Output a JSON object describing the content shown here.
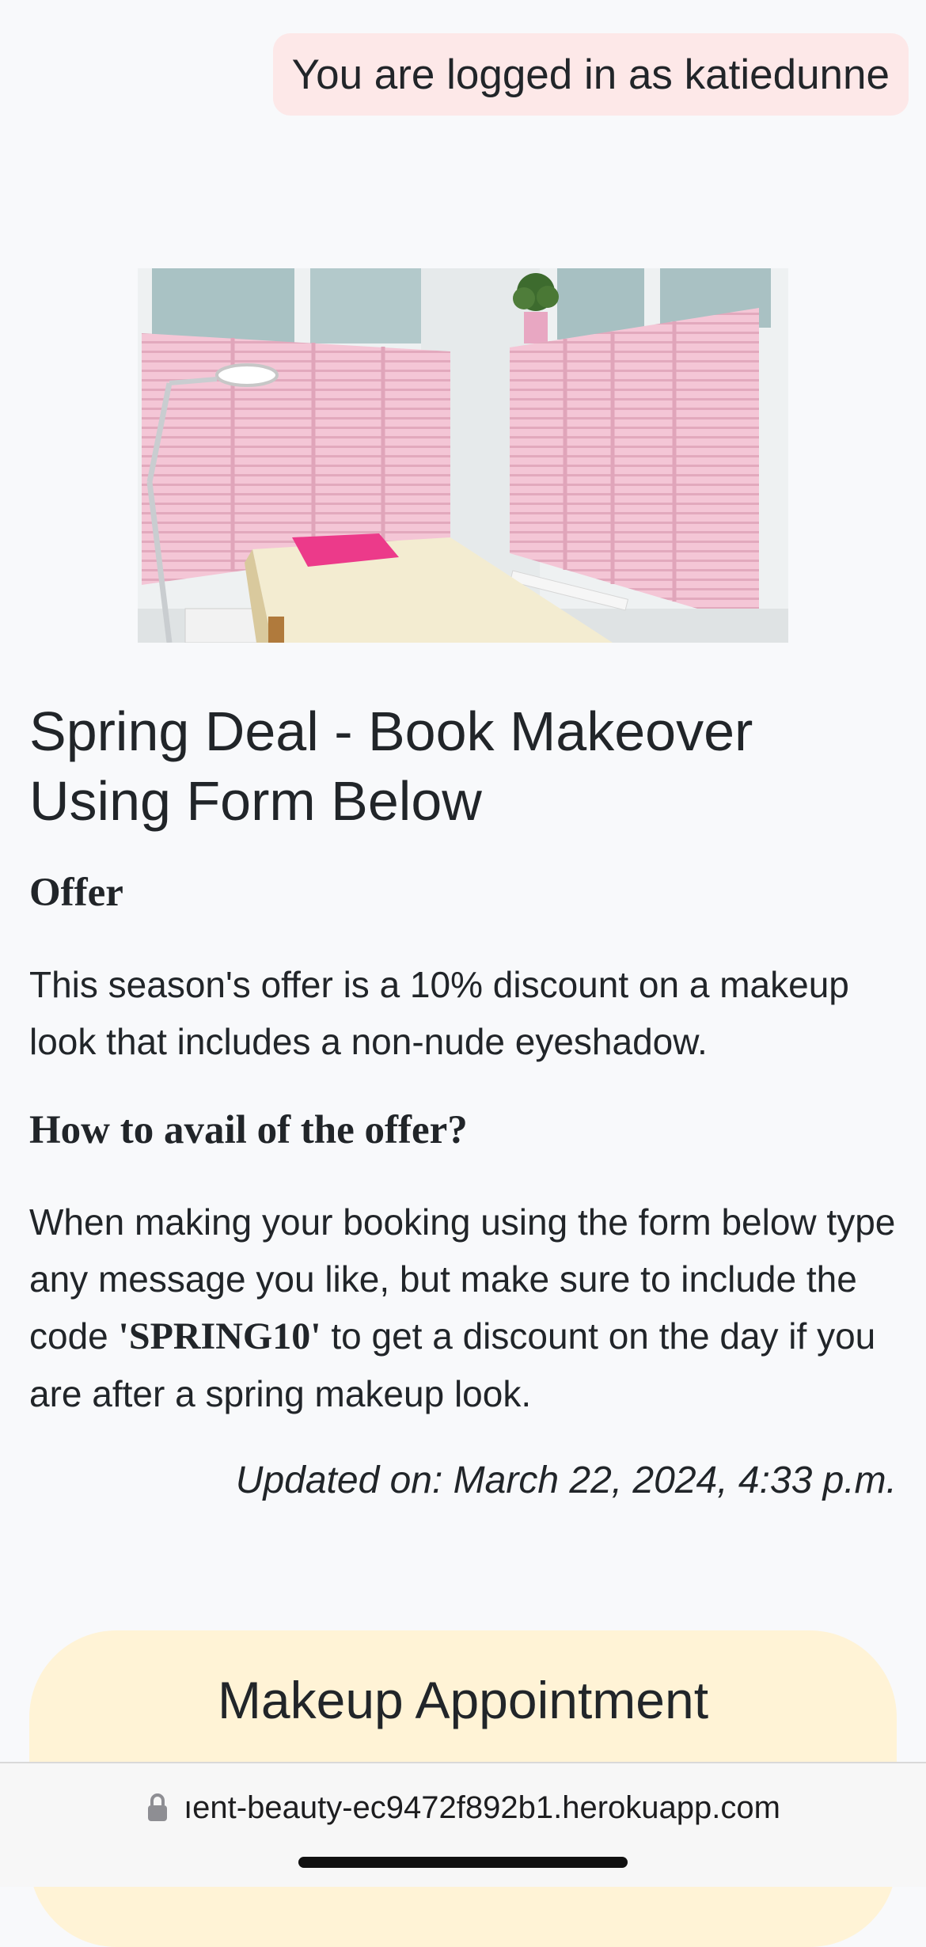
{
  "header": {
    "login_status": "You are logged in as katiedunne"
  },
  "post": {
    "title": "Spring Deal - Book Makeover Using Form Below",
    "offer_heading": "Offer",
    "offer_text": "This season's offer is a 10% discount on a makeup look that includes a non-nude eyeshadow.",
    "how_heading": "How to avail of the offer?",
    "how_text_before": "When making your booking using the form below type any message you like, but make sure to include the code ",
    "how_code": "'SPRING10'",
    "how_text_after": " to get a discount on the day if you are after a spring makeup look.",
    "updated": "Updated on: March 22, 2024, 4:33 p.m."
  },
  "appointment": {
    "title": "Makeup Appointment"
  },
  "browser": {
    "url": "ıent-beauty-ec9472f892b1.herokuapp.com"
  },
  "icons": {
    "lock": "lock-icon"
  },
  "colors": {
    "page_background": "#f8f9fb",
    "login_badge_background": "#fde8e8",
    "appointment_card_background": "#fff3d6",
    "shutter_pink": "#f4c6d6",
    "pillow_pink": "#ec3a8a"
  }
}
